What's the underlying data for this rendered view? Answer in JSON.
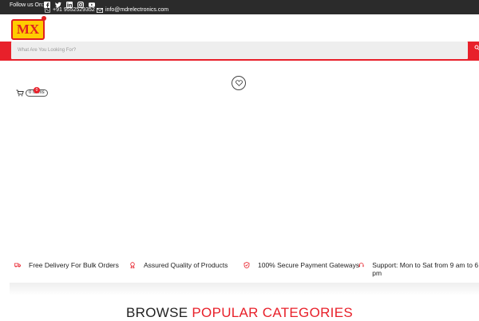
{
  "topbar": {
    "follow_label": "Follow us On:",
    "social_icons": [
      "facebook-icon",
      "twitter-icon",
      "linkedin-icon",
      "instagram-icon",
      "youtube-icon"
    ],
    "phone": "+91 9552529352",
    "email": "info@mdrelectronics.com"
  },
  "logo": {
    "text": "MX"
  },
  "search": {
    "placeholder": "What Are You Looking For?"
  },
  "cart": {
    "count": "0",
    "items_label": "0 Items"
  },
  "features": [
    {
      "icon": "delivery-icon",
      "label": "Free Delivery For Bulk Orders"
    },
    {
      "icon": "quality-icon",
      "label": "Assured Quality of Products"
    },
    {
      "icon": "secure-icon",
      "label": "100% Secure Payment Gateways"
    },
    {
      "icon": "support-icon",
      "label": "Support: Mon to Sat from 9 am to 6 pm"
    }
  ],
  "section": {
    "heading_dark": "BROWSE",
    "heading_red": "POPULAR CATEGORIES"
  },
  "colors": {
    "brand_red": "#e8202a",
    "topbar": "#2b2b2b",
    "logo_yellow": "#ffcc00"
  }
}
